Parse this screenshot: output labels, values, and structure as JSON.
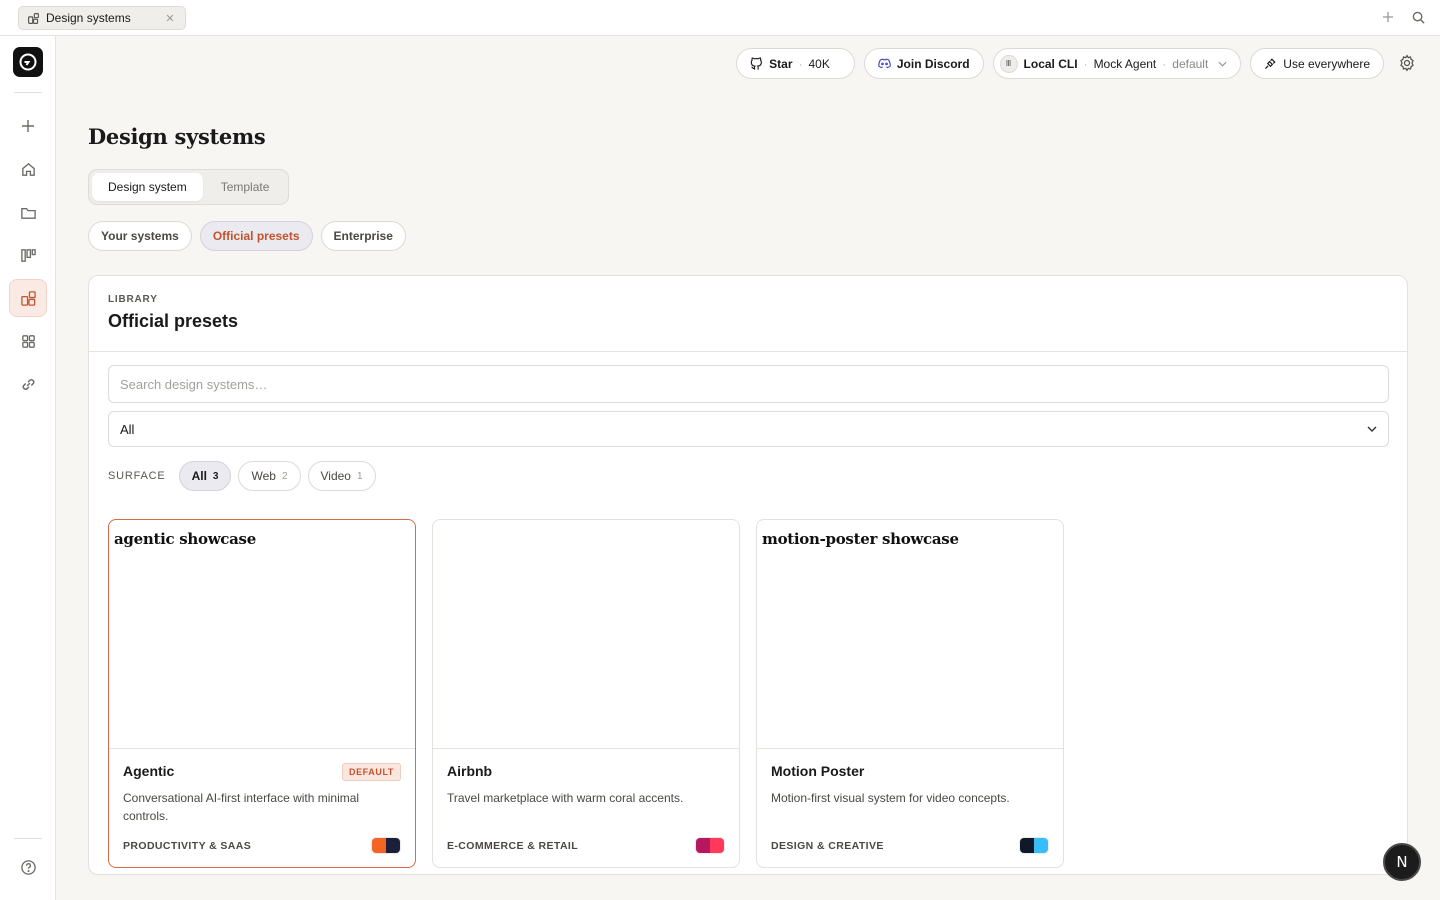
{
  "window": {
    "tab_title": "Design systems",
    "tab_icon": "design-systems-icon"
  },
  "topbar": {
    "star_label": "Star",
    "star_count": "40K",
    "discord_label": "Join Discord",
    "agent_source": "Local CLI",
    "agent_name": "Mock Agent",
    "agent_profile": "default",
    "use_everywhere_label": "Use everywhere"
  },
  "page": {
    "title": "Design systems",
    "segments": [
      "Design system",
      "Template"
    ],
    "active_segment": "Design system",
    "filter_chips": [
      "Your systems",
      "Official presets",
      "Enterprise"
    ],
    "active_filter": "Official presets"
  },
  "panel": {
    "eyebrow": "LIBRARY",
    "title": "Official presets",
    "search_placeholder": "Search design systems…",
    "category_select": "All",
    "surface_label": "SURFACE",
    "surface_filters": [
      {
        "label": "All",
        "count": "3"
      },
      {
        "label": "Web",
        "count": "2"
      },
      {
        "label": "Video",
        "count": "1"
      }
    ]
  },
  "cards": [
    {
      "preview_text": "agentic showcase",
      "name": "Agentic",
      "badge": "DEFAULT",
      "description": "Conversational AI-first interface with minimal controls.",
      "category": "PRODUCTIVITY & SAAS",
      "swatch": [
        "#f26522",
        "#1b1f3a"
      ],
      "selected": true
    },
    {
      "preview_text": "",
      "name": "Airbnb",
      "badge": "",
      "description": "Travel marketplace with warm coral accents.",
      "category": "E-COMMERCE & RETAIL",
      "swatch": [
        "#b5185e",
        "#ff385c"
      ],
      "selected": false
    },
    {
      "preview_text": "motion-poster showcase",
      "name": "Motion Poster",
      "badge": "",
      "description": "Motion-first visual system for video concepts.",
      "category": "DESIGN & CREATIVE",
      "swatch": [
        "#111827",
        "#38bdf8"
      ],
      "selected": false
    }
  ],
  "floating_button": "N",
  "colors": {
    "accent": "#c2542d",
    "selected_border": "#d96a4a"
  }
}
